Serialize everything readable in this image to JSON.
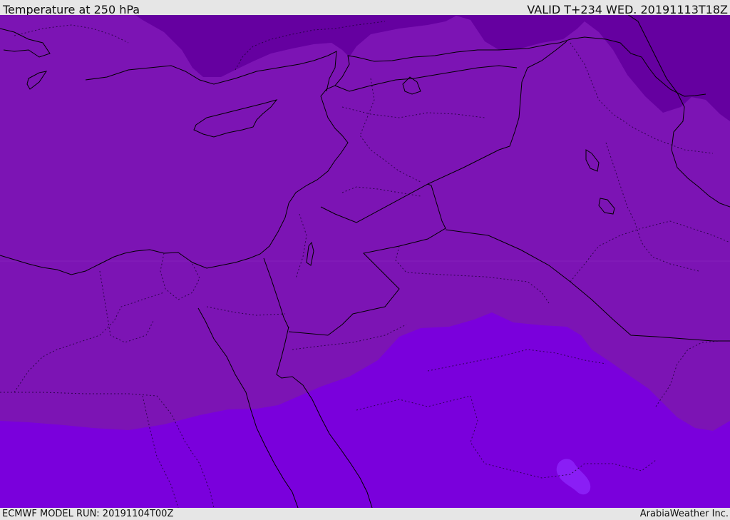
{
  "header": {
    "title": "Temperature at 250 hPa",
    "valid": "VALID T+234 WED. 20191113T18Z"
  },
  "footer": {
    "model_run": "ECMWF MODEL RUN: 20191104T00Z",
    "credit": "ArabiaWeather Inc."
  },
  "map": {
    "colors": {
      "cold_band": "#6500a0",
      "mid_band": "#7c14b4",
      "warm_band": "#7a00dc",
      "warmest_patch": "#8a1ef5",
      "coastline": "#000000",
      "borders": "#1a0033"
    }
  }
}
